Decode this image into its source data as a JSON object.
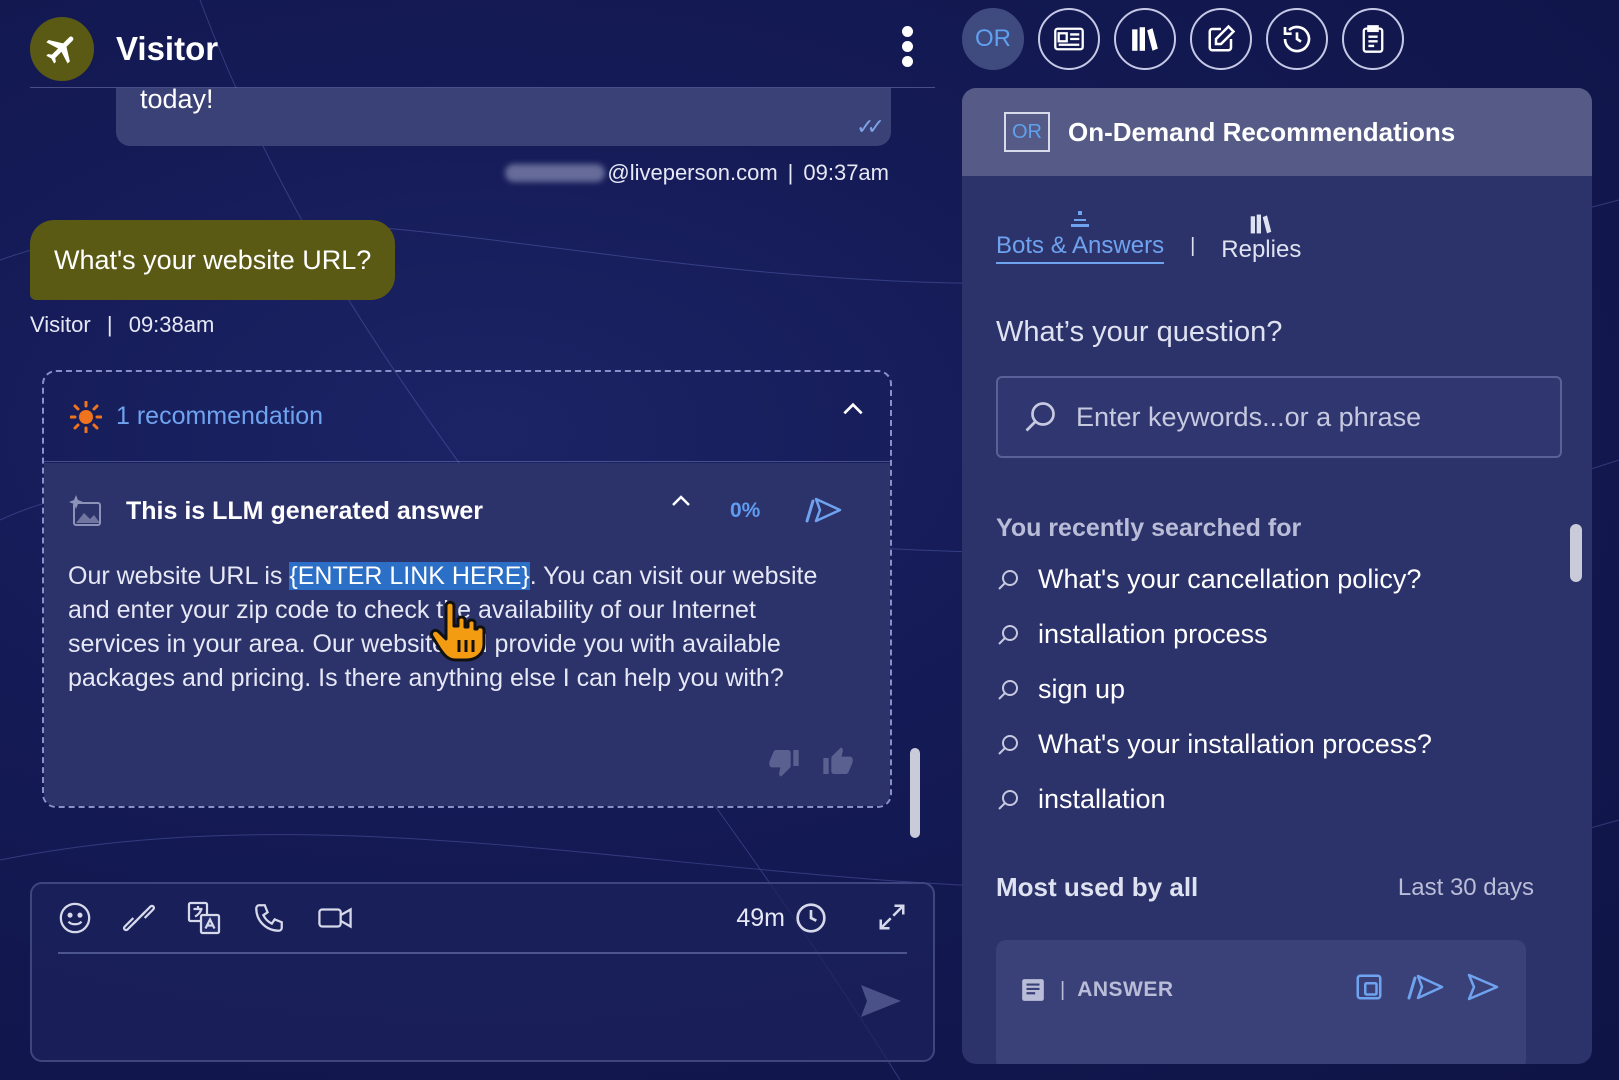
{
  "chat": {
    "visitor_name": "Visitor",
    "agent_message_tail": "today!",
    "agent_email_suffix": "@liveperson.com",
    "agent_time": "09:37am",
    "visitor_message": "What's your website URL?",
    "visitor_label": "Visitor",
    "visitor_time": "09:38am",
    "meta_separator": "|"
  },
  "recommendation": {
    "count_label": "1 recommendation",
    "answer_title": "This is LLM generated answer",
    "confidence": "0%",
    "text_before": "Our website URL is ",
    "link_placeholder": "{ENTER LINK HERE}",
    "text_after": ". You can visit our website and enter your zip code to check the availability of our Internet services in your area. Our website will provide you with available packages and pricing. Is there anything else I can help you with?"
  },
  "composer": {
    "timer": "49m"
  },
  "toolbar": {
    "active_label": "OR"
  },
  "panel": {
    "badge": "OR",
    "title": "On-Demand Recommendations",
    "tabs": [
      {
        "label": "Bots & Answers",
        "active": true
      },
      {
        "label": "Replies",
        "active": false
      }
    ],
    "tab_separator": "|",
    "question_label": "What’s your question?",
    "search_placeholder": "Enter keywords...or a phrase",
    "recent_title": "You recently searched for",
    "recent_searches": [
      "What's your cancellation policy?",
      "installation process",
      "sign up",
      "What's your installation process?",
      "installation"
    ],
    "most_used_title": "Most used by all",
    "period": "Last 30 days",
    "answer_type": "ANSWER",
    "answer_separator": "|"
  },
  "colors": {
    "accent": "#6fa3ef",
    "visitor_bubble": "#5b5a15",
    "agent_bubble": "#3a4176",
    "highlight": "#2b6fc6",
    "cursor": "#f39c12"
  }
}
